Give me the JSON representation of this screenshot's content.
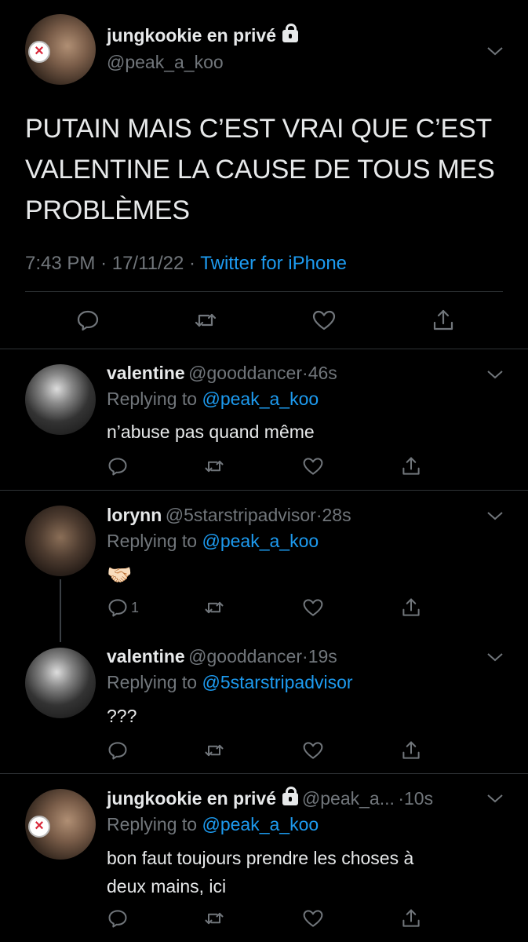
{
  "main_tweet": {
    "display_name": "jungkookie en privé",
    "handle": "@peak_a_koo",
    "text": "PUTAIN MAIS C’EST VRAI QUE C’EST VALENTINE LA CAUSE DE TOUS MES PROBLÈMES",
    "time": "7:43 PM",
    "sep1": "·",
    "date": "17/11/22",
    "sep2": "·",
    "source": "Twitter for iPhone"
  },
  "replies": [
    {
      "display_name": "valentine",
      "handle": "@gooddancer",
      "dot": "·",
      "age": "46s",
      "replying_prefix": "Replying to",
      "replying_to": "@peak_a_koo",
      "text": "n’abuse pas quand même",
      "reply_count": ""
    },
    {
      "display_name": "lorynn",
      "handle": "@5starstripadvisor",
      "dot": "·",
      "age": "28s",
      "replying_prefix": "Replying to",
      "replying_to": "@peak_a_koo",
      "text": "🤝🏻",
      "reply_count": "1"
    },
    {
      "display_name": "valentine",
      "handle": "@gooddancer",
      "dot": "·",
      "age": "19s",
      "replying_prefix": "Replying to",
      "replying_to": "@5starstripadvisor",
      "text": "???",
      "reply_count": ""
    },
    {
      "display_name": "jungkookie en privé",
      "handle": "@peak_a...",
      "dot": "·",
      "age": "10s",
      "replying_prefix": "Replying to",
      "replying_to": "@peak_a_koo",
      "text_line1": "bon faut toujours prendre les choses à",
      "text_line2": "deux mains, ici",
      "reply_count": ""
    }
  ],
  "icons": {
    "reply": "reply-icon",
    "retweet": "retweet-icon",
    "like": "heart-icon",
    "share": "share-icon",
    "more": "chevron-down-icon",
    "lock": "lock-icon"
  },
  "colors": {
    "background": "#000000",
    "text": "#e7e9ea",
    "muted": "#71767b",
    "link": "#1d9bf0",
    "divider": "#2f3336"
  }
}
